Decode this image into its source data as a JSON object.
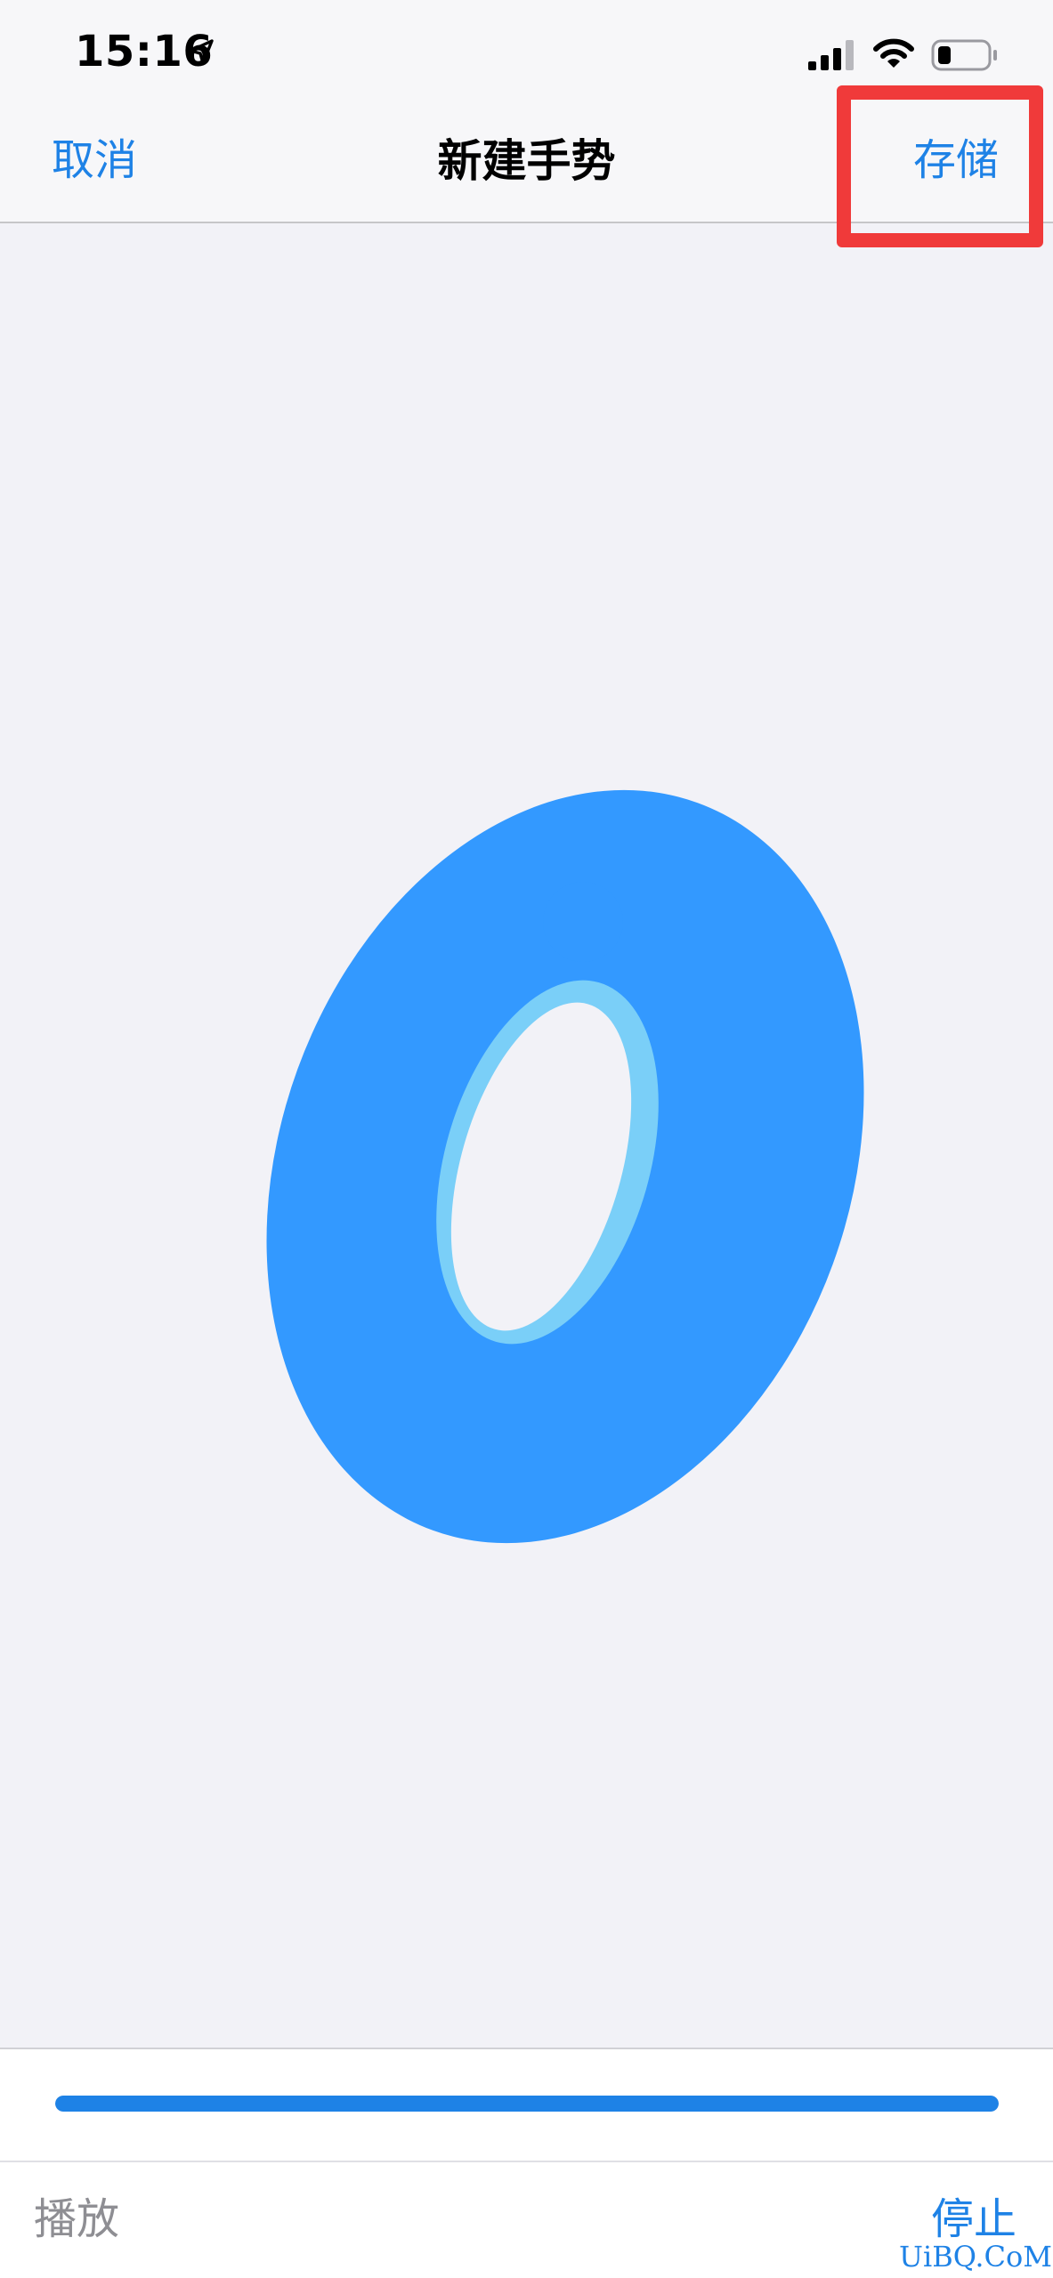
{
  "status_bar": {
    "time": "15:16",
    "icons": [
      "location-arrow-icon",
      "cellular-signal-icon",
      "wifi-icon",
      "battery-icon"
    ]
  },
  "nav_bar": {
    "cancel_label": "取消",
    "title": "新建手势",
    "save_label": "存储"
  },
  "canvas": {
    "gesture_shape": "hand-drawn-zero",
    "colors": {
      "primary_stroke": "#3399FF",
      "trail_stroke": "#7ACFF8"
    }
  },
  "playback": {
    "progress": 1.0
  },
  "toolbar": {
    "play_label": "播放",
    "stop_label": "停止"
  },
  "watermark": "UiBQ.CoM",
  "colors": {
    "accent": "#1E82E6",
    "highlight": "#F03A3A",
    "background": "#F2F2F7"
  }
}
